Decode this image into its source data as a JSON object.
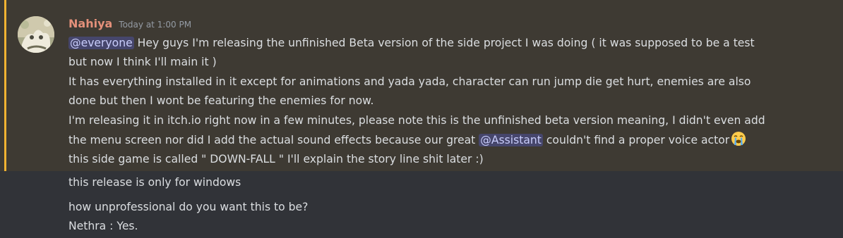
{
  "message": {
    "author": "Nahiya",
    "timestamp": "Today at 1:00 PM",
    "mention_everyone": "@everyone",
    "line1_rest": " Hey guys I'm releasing the unfinished Beta version of the side project I was doing ( it was supposed to be a test",
    "line2": "but now I think I'll main it )",
    "line3": "It has everything installed in it except for animations and yada yada, character can run jump die get hurt, enemies are also",
    "line4": "done but then I wont be featuring the enemies for now.",
    "line5": "I'm releasing it in itch.io right now in a few minutes, please note this is the unfinished beta version meaning, I didn't even add",
    "line6_pre": "the menu screen nor did I add the actual sound effects because our great ",
    "mention_assistant": "@Assistant",
    "line6_post": " couldn't find a proper voice actor",
    "emoji": "sob-emoji",
    "line7": "this side game is called \" DOWN-FALL \" I'll explain the story line shit later :)"
  },
  "followups": [
    "this release is only for windows",
    "how unprofessional do you want this to be?",
    "Nethra : Yes."
  ],
  "colors": {
    "background": "#313338",
    "highlight": "#3e3a33",
    "highlight_bar": "#f0b232",
    "username": "#e4907a",
    "mention_bg": "#5865f2"
  }
}
